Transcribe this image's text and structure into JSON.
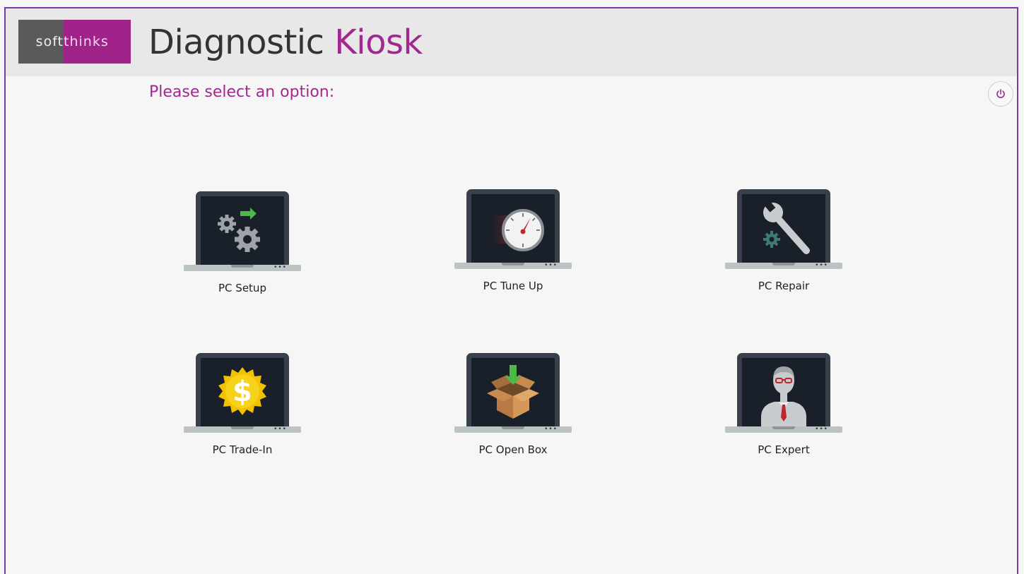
{
  "app": {
    "logo_left": "soft",
    "logo_right": "thinks",
    "title_main": "Diagnostic",
    "title_accent": "Kiosk",
    "prompt": "Please select an option:"
  },
  "options": [
    {
      "label": "PC Setup",
      "icon": "gears-icon"
    },
    {
      "label": "PC Tune Up",
      "icon": "speedometer-icon"
    },
    {
      "label": "PC Repair",
      "icon": "wrench-icon"
    },
    {
      "label": "PC Trade-In",
      "icon": "dollar-badge-icon"
    },
    {
      "label": "PC Open Box",
      "icon": "open-box-icon"
    },
    {
      "label": "PC Expert",
      "icon": "expert-person-icon"
    }
  ],
  "colors": {
    "brand_purple": "#a0288e",
    "logo_gray": "#5a5a5a",
    "screen_dark": "#19202a",
    "arrow_green": "#4cb848"
  }
}
